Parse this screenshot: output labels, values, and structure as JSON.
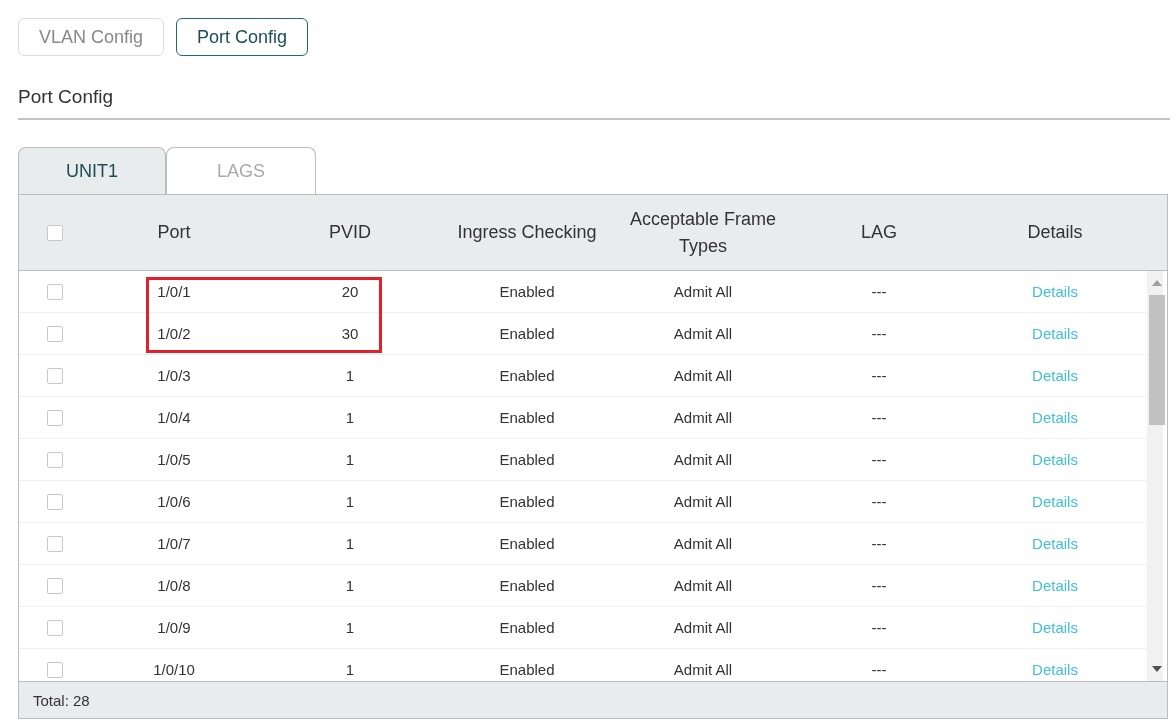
{
  "top_tabs": [
    {
      "label": "VLAN Config",
      "selected": false
    },
    {
      "label": "Port Config",
      "selected": true
    }
  ],
  "section_title": "Port Config",
  "unit_tabs": [
    {
      "label": "UNIT1",
      "selected": true
    },
    {
      "label": "LAGS",
      "selected": false
    }
  ],
  "table": {
    "select_all_checked": false,
    "columns": [
      "Port",
      "PVID",
      "Ingress Checking",
      "Acceptable Frame Types",
      "LAG",
      "Details"
    ],
    "rows": [
      {
        "checked": false,
        "highlighted": true,
        "port": "1/0/1",
        "pvid": "20",
        "ingress": "Enabled",
        "frame_types": "Admit All",
        "lag": "---",
        "details": "Details"
      },
      {
        "checked": false,
        "highlighted": true,
        "port": "1/0/2",
        "pvid": "30",
        "ingress": "Enabled",
        "frame_types": "Admit All",
        "lag": "---",
        "details": "Details"
      },
      {
        "checked": false,
        "highlighted": false,
        "port": "1/0/3",
        "pvid": "1",
        "ingress": "Enabled",
        "frame_types": "Admit All",
        "lag": "---",
        "details": "Details"
      },
      {
        "checked": false,
        "highlighted": false,
        "port": "1/0/4",
        "pvid": "1",
        "ingress": "Enabled",
        "frame_types": "Admit All",
        "lag": "---",
        "details": "Details"
      },
      {
        "checked": false,
        "highlighted": false,
        "port": "1/0/5",
        "pvid": "1",
        "ingress": "Enabled",
        "frame_types": "Admit All",
        "lag": "---",
        "details": "Details"
      },
      {
        "checked": false,
        "highlighted": false,
        "port": "1/0/6",
        "pvid": "1",
        "ingress": "Enabled",
        "frame_types": "Admit All",
        "lag": "---",
        "details": "Details"
      },
      {
        "checked": false,
        "highlighted": false,
        "port": "1/0/7",
        "pvid": "1",
        "ingress": "Enabled",
        "frame_types": "Admit All",
        "lag": "---",
        "details": "Details"
      },
      {
        "checked": false,
        "highlighted": false,
        "port": "1/0/8",
        "pvid": "1",
        "ingress": "Enabled",
        "frame_types": "Admit All",
        "lag": "---",
        "details": "Details"
      },
      {
        "checked": false,
        "highlighted": false,
        "port": "1/0/9",
        "pvid": "1",
        "ingress": "Enabled",
        "frame_types": "Admit All",
        "lag": "---",
        "details": "Details"
      },
      {
        "checked": false,
        "highlighted": false,
        "port": "1/0/10",
        "pvid": "1",
        "ingress": "Enabled",
        "frame_types": "Admit All",
        "lag": "---",
        "details": "Details"
      }
    ],
    "total": "Total: 28"
  }
}
